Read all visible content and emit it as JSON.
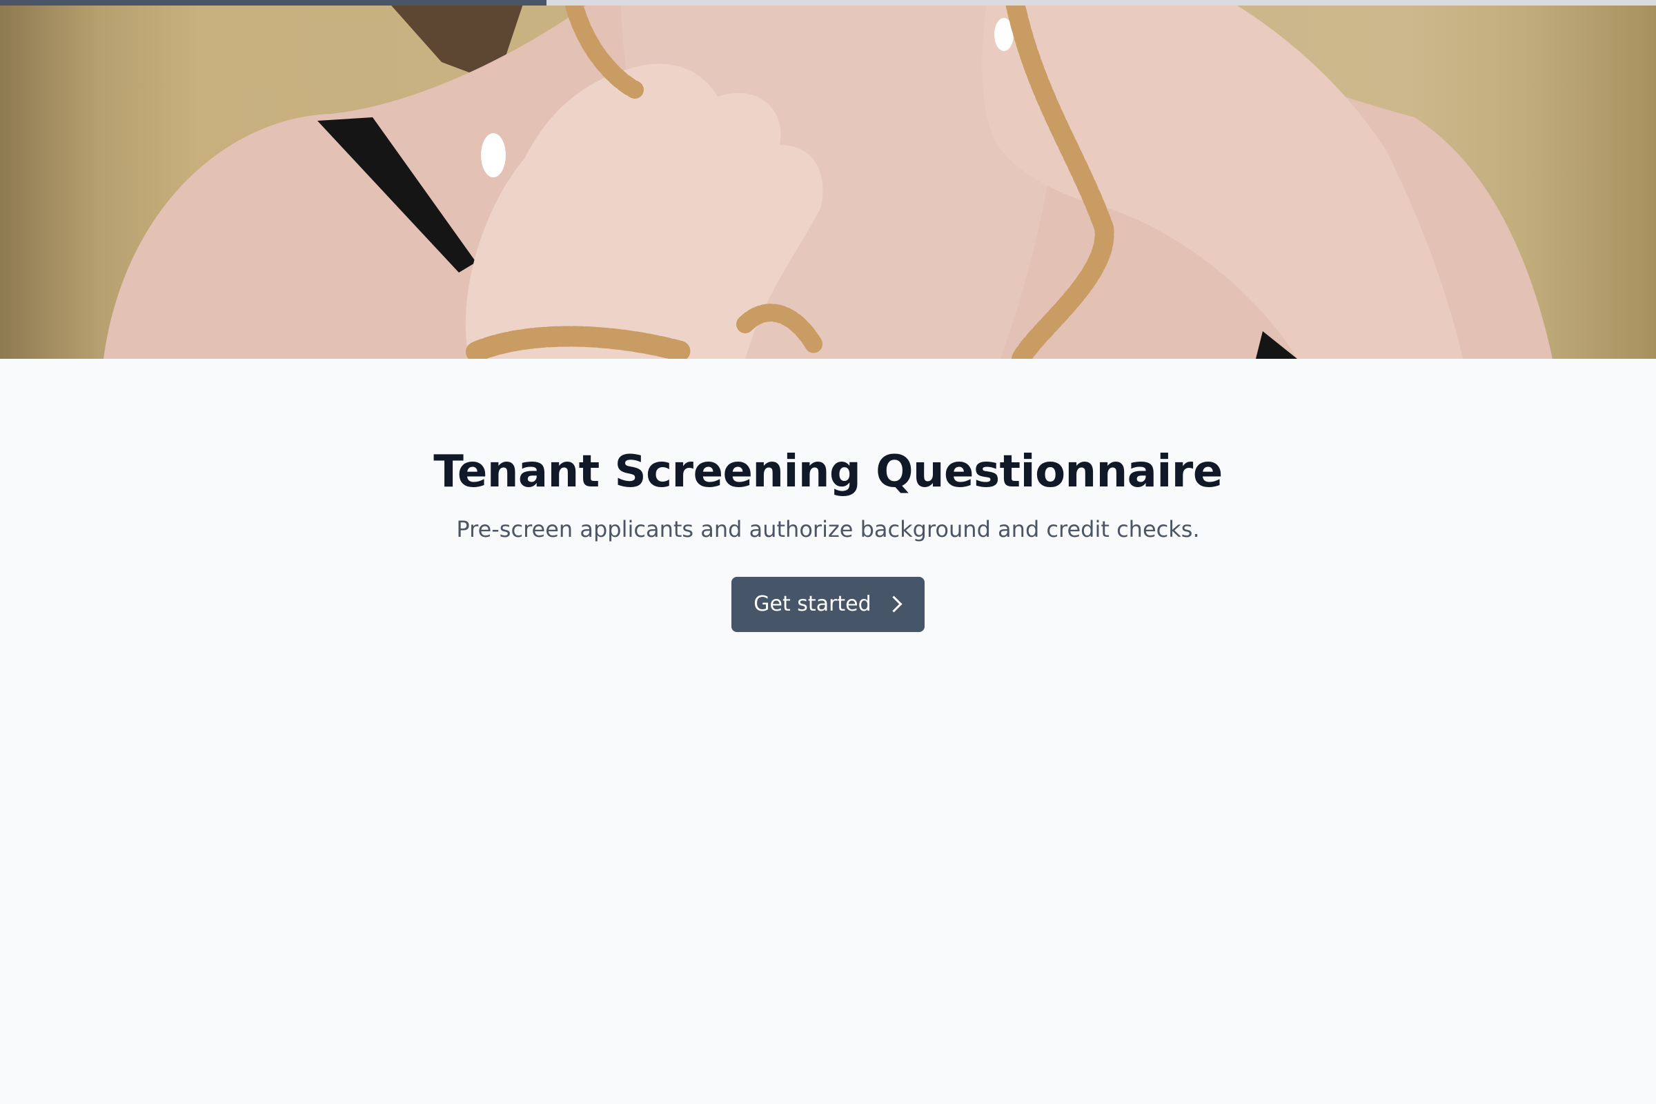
{
  "progress": {
    "fraction": 0.33,
    "fill_color": "#4a5568",
    "track_color": "#d9dbe0"
  },
  "hero": {
    "icon": "hero-photo-necklace"
  },
  "form": {
    "title": "Tenant Screening Questionnaire",
    "subtitle": "Pre-screen applicants and authorize background and credit checks.",
    "start_button_label": "Get started",
    "start_button_icon": "chevron-right-icon",
    "accent_color": "#475569"
  }
}
